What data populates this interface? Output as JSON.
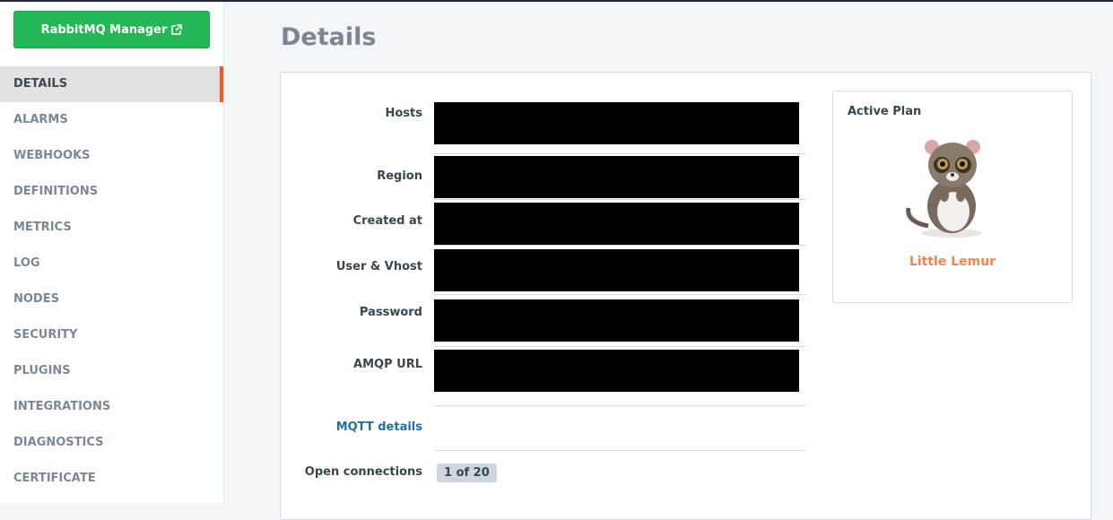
{
  "sidebar": {
    "manager_button": "RabbitMQ Manager",
    "items": [
      {
        "label": "DETAILS",
        "active": true
      },
      {
        "label": "ALARMS"
      },
      {
        "label": "WEBHOOKS"
      },
      {
        "label": "DEFINITIONS"
      },
      {
        "label": "METRICS"
      },
      {
        "label": "LOG"
      },
      {
        "label": "NODES"
      },
      {
        "label": "SECURITY"
      },
      {
        "label": "PLUGINS"
      },
      {
        "label": "INTEGRATIONS"
      },
      {
        "label": "DIAGNOSTICS"
      },
      {
        "label": "CERTIFICATE"
      }
    ]
  },
  "page": {
    "title": "Details"
  },
  "details": {
    "hosts": "Hosts",
    "region": "Region",
    "created_at": "Created at",
    "user_vhost": "User & Vhost",
    "password": "Password",
    "amqp_url": "AMQP URL",
    "mqtt_link": "MQTT details",
    "open_connections": "Open connections",
    "connections_badge": "1 of 20"
  },
  "plan": {
    "heading": "Active Plan",
    "name": "Little Lemur"
  },
  "colors": {
    "accent": "#ef5a28",
    "green": "#24b756",
    "plan": "#f5854f",
    "link": "#1f6fa8"
  }
}
